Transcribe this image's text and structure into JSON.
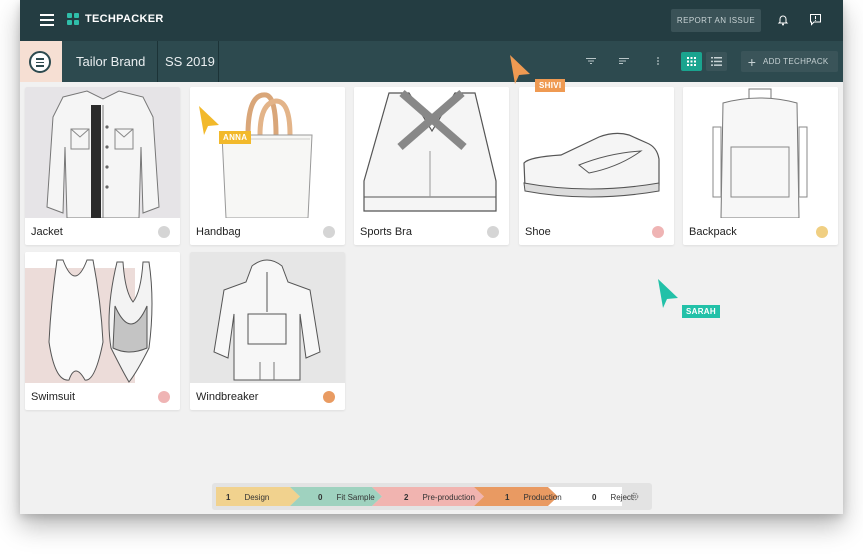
{
  "app": {
    "logo_text": "TECHPACKER"
  },
  "header": {
    "report_label": "REPORT AN ISSUE"
  },
  "subbar": {
    "brand": "Tailor Brand",
    "season": "SS 2019",
    "add_label": "ADD TECHPACK"
  },
  "products": [
    {
      "name": "Jacket",
      "status_color": "#d5d5d5"
    },
    {
      "name": "Handbag",
      "status_color": "#d5d5d5"
    },
    {
      "name": "Sports Bra",
      "status_color": "#d5d5d5"
    },
    {
      "name": "Shoe",
      "status_color": "#efb4b4"
    },
    {
      "name": "Backpack",
      "status_color": "#f0cf82"
    },
    {
      "name": "Swimsuit",
      "status_color": "#efb4b4"
    },
    {
      "name": "Windbreaker",
      "status_color": "#e99b62"
    }
  ],
  "cursors": [
    {
      "name": "ANNA",
      "color": "#f2b92b"
    },
    {
      "name": "SHIVI",
      "color": "#ef9a52"
    },
    {
      "name": "SARAH",
      "color": "#22c1a8"
    }
  ],
  "stages": [
    {
      "count": "1",
      "label": "Design",
      "color": "#f1d28e"
    },
    {
      "count": "0",
      "label": "Fit Sample",
      "color": "#9fd2bf"
    },
    {
      "count": "2",
      "label": "Pre-production",
      "color": "#f1b4b0"
    },
    {
      "count": "1",
      "label": "Production",
      "color": "#e99a62"
    },
    {
      "count": "0",
      "label": "Reject",
      "color": "#ffffff"
    }
  ]
}
